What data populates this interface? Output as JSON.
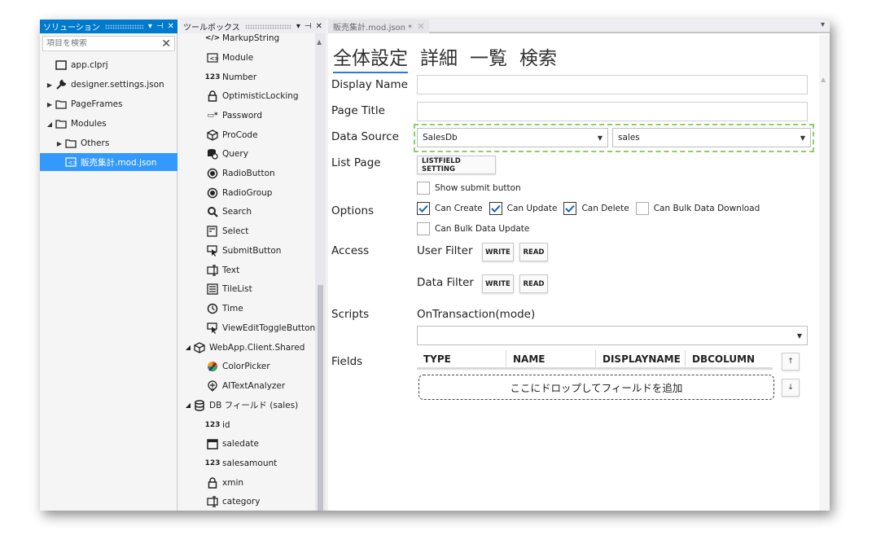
{
  "solution": {
    "title": "ソリューション",
    "buttons": [
      "▾",
      "⊣",
      "✕"
    ],
    "search_placeholder": "項目を検索",
    "items": [
      {
        "label": "app.clprj",
        "icon": "project-icon"
      },
      {
        "label": "designer.settings.json",
        "icon": "wrench-icon"
      },
      {
        "label": "PageFrames",
        "icon": "folder-icon"
      },
      {
        "label": "Modules",
        "icon": "folder-icon"
      },
      {
        "label": "Others",
        "icon": "folder-icon"
      },
      {
        "label": "販売集計.mod.json",
        "icon": "module-icon"
      }
    ]
  },
  "toolbox": {
    "title": "ツールボックス",
    "buttons": [
      "▾",
      "⊣",
      "✕"
    ],
    "items": [
      {
        "label": "MarkupString",
        "icon": "markup-icon"
      },
      {
        "label": "Module",
        "icon": "module-icon"
      },
      {
        "label": "Number",
        "icon": "number-icon"
      },
      {
        "label": "OptimisticLocking",
        "icon": "lock-icon"
      },
      {
        "label": "Password",
        "icon": "password-icon"
      },
      {
        "label": "ProCode",
        "icon": "cube-icon"
      },
      {
        "label": "Query",
        "icon": "query-icon"
      },
      {
        "label": "RadioButton",
        "icon": "radio-icon"
      },
      {
        "label": "RadioGroup",
        "icon": "radio-icon"
      },
      {
        "label": "Search",
        "icon": "search-icon"
      },
      {
        "label": "Select",
        "icon": "select-icon"
      },
      {
        "label": "SubmitButton",
        "icon": "cursor-icon"
      },
      {
        "label": "Text",
        "icon": "text-icon"
      },
      {
        "label": "TileList",
        "icon": "list-icon"
      },
      {
        "label": "Time",
        "icon": "clock-icon"
      },
      {
        "label": "ViewEditToggleButton",
        "icon": "cursor-icon"
      },
      {
        "label": "WebApp.Client.Shared",
        "icon": "cube-icon"
      },
      {
        "label": "ColorPicker",
        "icon": "color-icon"
      },
      {
        "label": "AITextAnalyzer",
        "icon": "ai-icon"
      },
      {
        "label": "DB フィールド (sales)",
        "icon": "database-icon"
      },
      {
        "label": "id",
        "icon": "number-icon"
      },
      {
        "label": "saledate",
        "icon": "calendar-icon"
      },
      {
        "label": "salesamount",
        "icon": "number-icon"
      },
      {
        "label": "xmin",
        "icon": "lock-icon"
      },
      {
        "label": "category",
        "icon": "text-icon"
      }
    ]
  },
  "editor": {
    "tab_label": "販売集計.mod.json *",
    "tabs": [
      "全体設定",
      "詳細",
      "一覧",
      "検索"
    ],
    "labels": {
      "display_name": "Display Name",
      "page_title": "Page Title",
      "data_source": "Data Source",
      "list_page": "List Page",
      "options": "Options",
      "access": "Access",
      "scripts": "Scripts",
      "fields": "Fields"
    },
    "display_name_value": "",
    "page_title_value": "",
    "data_source_db": "SalesDb",
    "data_source_table": "sales",
    "listfield_button": "LISTFIELD SETTING",
    "checkboxes": {
      "show_submit": {
        "label": "Show submit button",
        "checked": false
      },
      "can_create": {
        "label": "Can Create",
        "checked": true
      },
      "can_update": {
        "label": "Can Update",
        "checked": true
      },
      "can_delete": {
        "label": "Can Delete",
        "checked": true
      },
      "can_bulk_download": {
        "label": "Can Bulk Data Download",
        "checked": false
      },
      "can_bulk_update": {
        "label": "Can Bulk Data Update",
        "checked": false
      }
    },
    "access": {
      "user_filter": "User Filter",
      "data_filter": "Data Filter",
      "write": "WRITE",
      "read": "READ"
    },
    "scripts_event": "OnTransaction(mode)",
    "scripts_value": "",
    "fields_columns": [
      "TYPE",
      "NAME",
      "DISPLAYNAME",
      "DBCOLUMN"
    ],
    "drop_zone_text": "ここにドロップしてフィールドを追加",
    "arrow_up": "↑",
    "arrow_down": "↓"
  },
  "colors": {
    "accent": "#007acc",
    "selection": "#3399ff",
    "tab_underline": "#2b7bd6",
    "dashed_highlight": "#8ccf6a"
  }
}
